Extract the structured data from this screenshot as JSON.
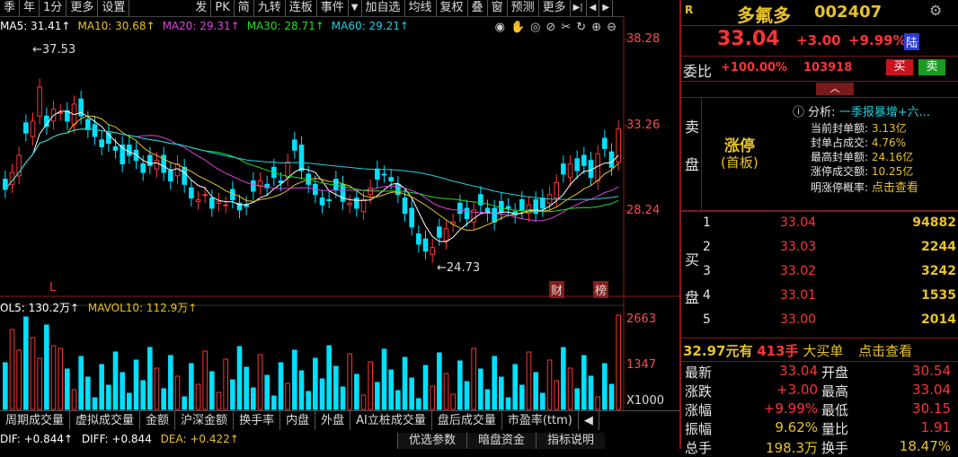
{
  "toolbar": {
    "items": [
      "季",
      "年",
      "1分",
      "更多",
      "设置"
    ],
    "items2": [
      "发",
      "PK",
      "简",
      "九转",
      "连板",
      "事件"
    ],
    "items3": [
      "加自选",
      "均线",
      "复权",
      "叠",
      "窗",
      "预测",
      "更多"
    ]
  },
  "ma": {
    "ma5": "MA5: 31.41↑",
    "ma10": "MA10: 30.68↑",
    "ma20": "MA20: 29.31↑",
    "ma30": "MA30: 28.71↑",
    "ma60": "MA60: 29.21↑"
  },
  "axis": {
    "price_ticks": [
      "38.28",
      "33.26",
      "28.24"
    ],
    "vol_ticks": [
      "2663",
      "1347",
      "X1000"
    ],
    "hi_label": "37.53",
    "lo_label": "24.73",
    "l_mark": "L",
    "cai_mark": "财",
    "bang_mark": "榜"
  },
  "vol": {
    "label1": "OL5: 130.2万↑",
    "label2": "MAVOL10: 112.9万↑"
  },
  "indicator_tabs": [
    "周期成交量",
    "虚拟成交量",
    "金额",
    "沪深金额",
    "换手率",
    "内盘",
    "外盘",
    "AI立桩成交量",
    "盘后成交量",
    "市盈率(ttm)"
  ],
  "macd": {
    "dif_label": "DIF: +0.844↑",
    "diff_label": "DIFF: +0.844",
    "dea_label": "DEA: +0.422↑"
  },
  "bottom_tabs": [
    "优选参数",
    "暗盘资金",
    "指标说明"
  ],
  "quote": {
    "r": "R",
    "name": "多氟多",
    "code": "002407",
    "price": "33.04",
    "change": "+3.00",
    "pct": "+9.99%",
    "board": "陆",
    "weibi_label": "委比",
    "weibi_pct": "+100.00%",
    "weibi_vol": "103918",
    "buy_btn": "买",
    "sell_btn": "卖",
    "sell_side": "卖",
    "sell_side2": "盘",
    "zt_title": "涨停",
    "zt_sub": "(首板)",
    "analysis_label": "分析:",
    "analysis_text": "一季报暴增+六...",
    "rows": [
      {
        "k": "当前封单额:",
        "v": "3.13亿"
      },
      {
        "k": "封单占成交:",
        "v": "4.76%"
      },
      {
        "k": "最高封单额:",
        "v": "24.16亿"
      },
      {
        "k": "涨停成交额:",
        "v": "10.25亿"
      },
      {
        "k": "明涨停概率:",
        "v": "点击查看"
      }
    ],
    "buy_side": "买",
    "buy_side2": "盘",
    "bids": [
      {
        "n": "1",
        "p": "33.04",
        "v": "94882"
      },
      {
        "n": "2",
        "p": "33.03",
        "v": "2244"
      },
      {
        "n": "3",
        "p": "33.02",
        "v": "3242"
      },
      {
        "n": "4",
        "p": "33.01",
        "v": "1535"
      },
      {
        "n": "5",
        "p": "33.00",
        "v": "2014"
      }
    ],
    "big_buy": {
      "amount": "32.97元有",
      "qty": "413手",
      "label": "大买单",
      "link": "点击查看"
    },
    "stats": [
      {
        "k1": "最新",
        "v1": "33.04",
        "k2": "开盘",
        "v2": "30.54"
      },
      {
        "k1": "涨跌",
        "v1": "+3.00",
        "k2": "最高",
        "v2": "33.04"
      },
      {
        "k1": "涨幅",
        "v1": "+9.99%",
        "k2": "最低",
        "v2": "30.15"
      },
      {
        "k1": "振幅",
        "v1": "9.62%",
        "k2": "量比",
        "v2": "1.91"
      },
      {
        "k1": "总手",
        "v1": "198.3万",
        "k2": "换手",
        "v2": "18.47%"
      }
    ]
  },
  "colors": {
    "up": "#ff3333",
    "down": "#00e0ff",
    "ma5": "#ffffff",
    "ma10": "#e8c228",
    "ma20": "#e040e0",
    "ma30": "#22dd22",
    "ma60": "#20d0e0"
  }
}
